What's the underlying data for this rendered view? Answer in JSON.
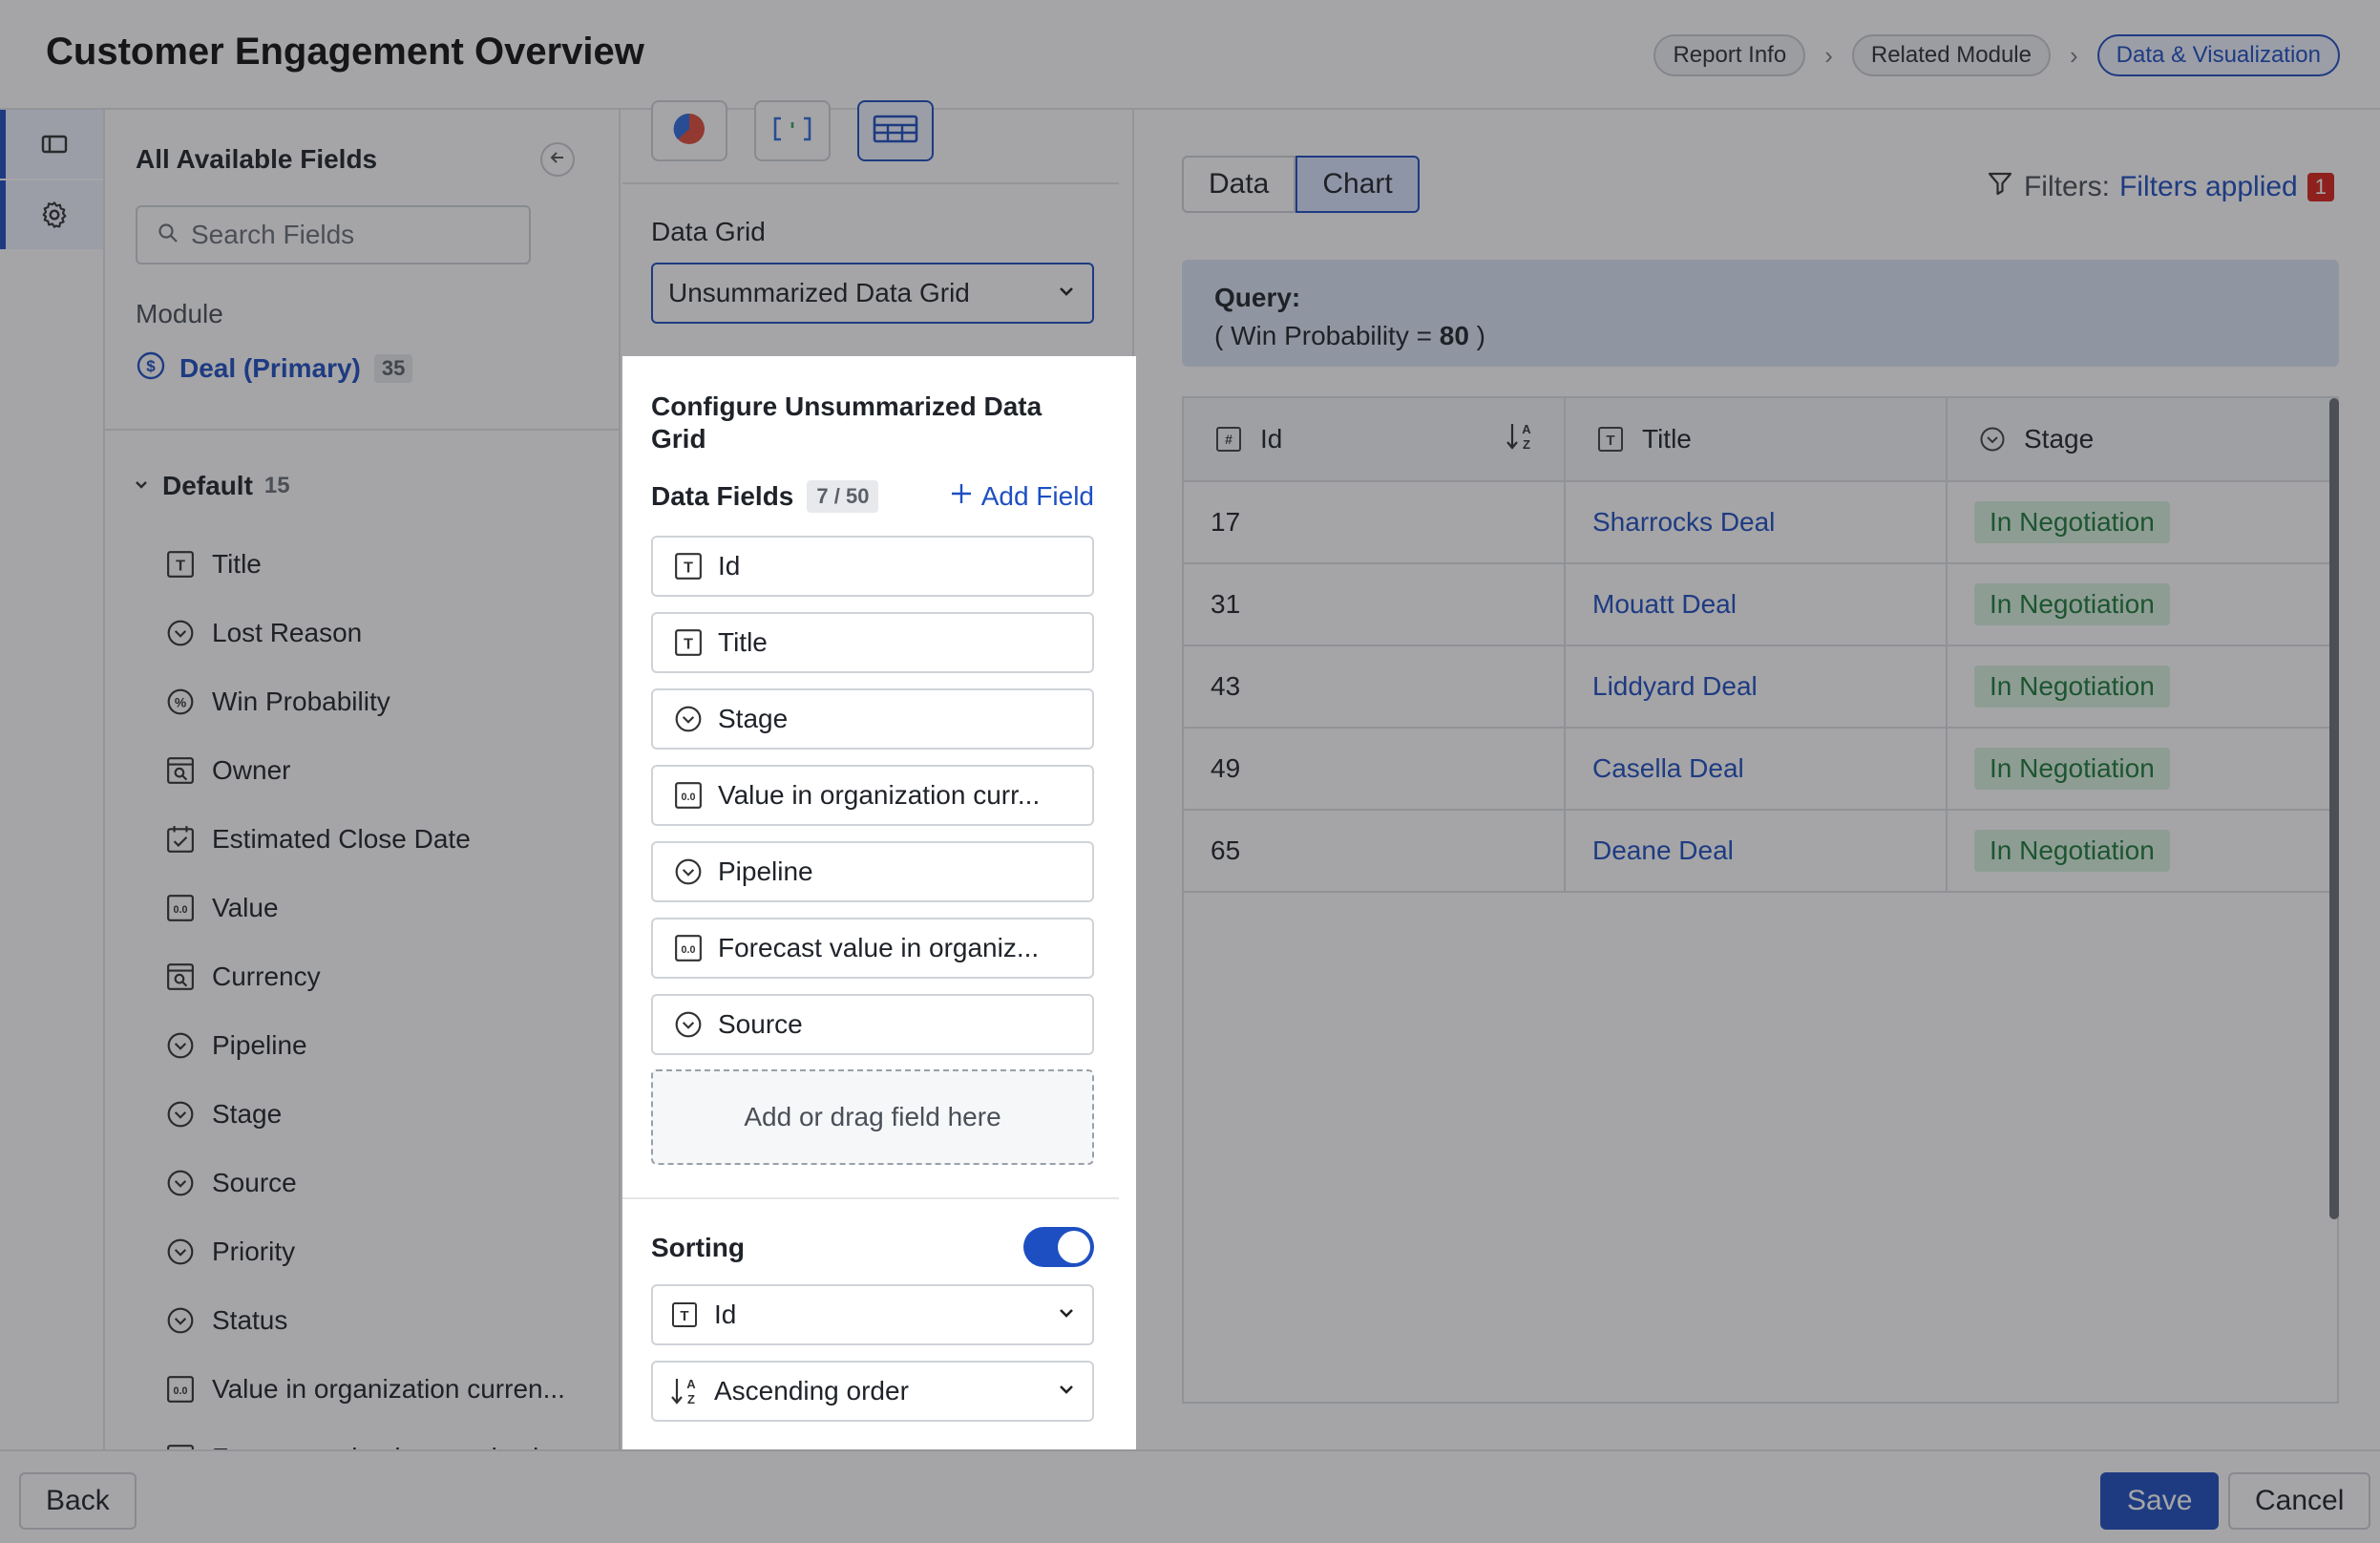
{
  "header": {
    "title": "Customer Engagement Overview",
    "breadcrumbs": [
      {
        "label": "Report Info"
      },
      {
        "label": "Related Module"
      },
      {
        "label": "Data & Visualization"
      }
    ]
  },
  "fields_panel": {
    "title": "All Available Fields",
    "search_placeholder": "Search Fields",
    "module_label": "Module",
    "module": {
      "name": "Deal (Primary)",
      "count": "35"
    },
    "group": {
      "name": "Default",
      "count": "15"
    },
    "items": [
      {
        "label": "Title",
        "icon": "text-field-icon"
      },
      {
        "label": "Lost Reason",
        "icon": "picklist-icon"
      },
      {
        "label": "Win Probability",
        "icon": "percent-icon"
      },
      {
        "label": "Owner",
        "icon": "lookup-icon"
      },
      {
        "label": "Estimated Close Date",
        "icon": "date-icon"
      },
      {
        "label": "Value",
        "icon": "number-field-icon"
      },
      {
        "label": "Currency",
        "icon": "lookup-icon"
      },
      {
        "label": "Pipeline",
        "icon": "picklist-icon"
      },
      {
        "label": "Stage",
        "icon": "picklist-icon"
      },
      {
        "label": "Source",
        "icon": "picklist-icon"
      },
      {
        "label": "Priority",
        "icon": "picklist-icon"
      },
      {
        "label": "Status",
        "icon": "picklist-icon"
      },
      {
        "label": "Value in organization curren...",
        "icon": "number-field-icon"
      },
      {
        "label": "Forecast value in organizati...",
        "icon": "number-field-icon"
      }
    ]
  },
  "config": {
    "grid_label": "Data Grid",
    "grid_value": "Unsummarized Data Grid",
    "card_title": "Configure Unsummarized Data Grid",
    "data_fields_label": "Data Fields",
    "data_fields_count": "7 / 50",
    "add_field_label": "Add Field",
    "data_fields": [
      {
        "label": "Id",
        "icon": "text-field-icon"
      },
      {
        "label": "Title",
        "icon": "text-field-icon"
      },
      {
        "label": "Stage",
        "icon": "picklist-icon"
      },
      {
        "label": "Value in organization curr...",
        "icon": "number-field-icon"
      },
      {
        "label": "Pipeline",
        "icon": "picklist-icon"
      },
      {
        "label": "Forecast value in organiz...",
        "icon": "number-field-icon"
      },
      {
        "label": "Source",
        "icon": "picklist-icon"
      }
    ],
    "drop_zone_label": "Add or drag field here",
    "sorting_label": "Sorting",
    "sorting_enabled": true,
    "sort_field": "Id",
    "sort_order": "Ascending order"
  },
  "preview": {
    "tabs": [
      {
        "label": "Data"
      },
      {
        "label": "Chart"
      }
    ],
    "active_tab": "Chart",
    "filters_label": "Filters:",
    "filters_link": "Filters applied",
    "filters_count": "1",
    "query_title": "Query:",
    "query_prefix": "( Win Probability = ",
    "query_value": "80",
    "query_suffix": " )",
    "columns": [
      {
        "label": "Id",
        "icon": "number-field-icon"
      },
      {
        "label": "Title",
        "icon": "text-field-icon"
      },
      {
        "label": "Stage",
        "icon": "picklist-icon"
      }
    ],
    "rows": [
      {
        "id": "17",
        "title": "Sharrocks Deal",
        "stage": "In Negotiation"
      },
      {
        "id": "31",
        "title": "Mouatt Deal",
        "stage": "In Negotiation"
      },
      {
        "id": "43",
        "title": "Liddyard Deal",
        "stage": "In Negotiation"
      },
      {
        "id": "49",
        "title": "Casella Deal",
        "stage": "In Negotiation"
      },
      {
        "id": "65",
        "title": "Deane Deal",
        "stage": "In Negotiation"
      }
    ]
  },
  "footer": {
    "back_label": "Back",
    "save_label": "Save",
    "cancel_label": "Cancel"
  },
  "colors": {
    "accent": "#1e4fc2",
    "stage_bg": "#d9f2df",
    "stage_text": "#1c7a3a",
    "badge_red": "#d9241b"
  }
}
